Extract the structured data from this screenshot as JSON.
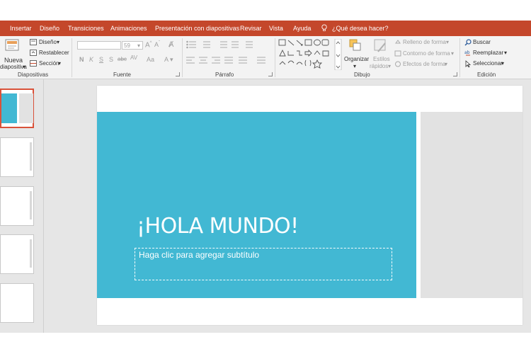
{
  "tabs": [
    {
      "label": "Insertar",
      "active": false
    },
    {
      "label": "Diseño",
      "active": false
    },
    {
      "label": "Transiciones",
      "active": false
    },
    {
      "label": "Animaciones",
      "active": false
    },
    {
      "label": "Presentación con diapositivas",
      "active": false
    },
    {
      "label": "Revisar",
      "active": false
    },
    {
      "label": "Vista",
      "active": false
    },
    {
      "label": "Ayuda",
      "active": false
    }
  ],
  "tell_me": "¿Qué desea hacer?",
  "ribbon": {
    "diapositivas": {
      "new_slide_line1": "Nueva",
      "new_slide_line2": "diapositiva",
      "layout": "Diseño",
      "reset": "Restablecer",
      "section": "Sección",
      "label": "Diapositivas"
    },
    "fuente": {
      "font_name": "",
      "font_size": "59",
      "bold": "N",
      "italic": "K",
      "underline": "S",
      "shadow": "S",
      "strike": "abc",
      "spacing": "AV",
      "case": "Aa",
      "label": "Fuente"
    },
    "parrafo": {
      "label": "Párrafo"
    },
    "dibujo": {
      "arrange": "Organizar",
      "quick_styles_line1": "Estilos",
      "quick_styles_line2": "rápidos",
      "fill": "Relleno de forma",
      "outline": "Contorno de forma",
      "effects": "Efectos de forma",
      "label": "Dibujo"
    },
    "edicion": {
      "find": "Buscar",
      "replace": "Reemplazar",
      "select": "Seleccionar",
      "label": "Edición"
    }
  },
  "slide": {
    "title": "¡HOLA MUNDO!",
    "subtitle_placeholder": "Haga clic para agregar subtítulo"
  },
  "colors": {
    "accent": "#c4472b",
    "slide_teal": "#42b8d3",
    "slide_gray": "#e2e2e2",
    "selected_thumb_border": "#d9523a"
  }
}
